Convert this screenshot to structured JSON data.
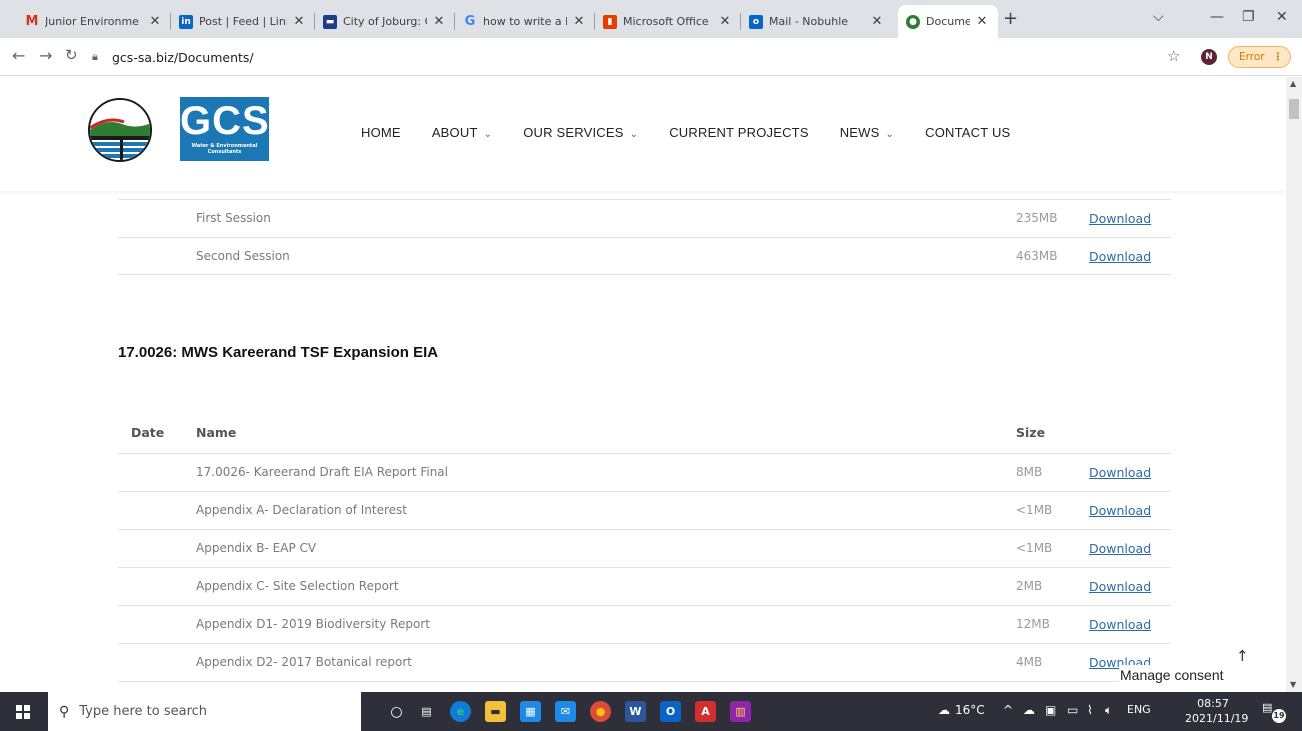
{
  "browser": {
    "tabs": [
      {
        "label": "Junior Environme",
        "icon": "gmail-icon"
      },
      {
        "label": "Post | Feed | Link",
        "icon": "linkedin-icon"
      },
      {
        "label": "City of Joburg: C",
        "icon": "joburg-icon"
      },
      {
        "label": "how to write a le",
        "icon": "google-icon"
      },
      {
        "label": "Microsoft Office",
        "icon": "office-icon"
      },
      {
        "label": "Mail - Nobuhle",
        "icon": "outlook-icon"
      },
      {
        "label": "Documents – GC",
        "icon": "gcs-icon"
      }
    ],
    "url": "gcs-sa.biz/Documents/",
    "profile_initial": "N",
    "error_label": "Error"
  },
  "site": {
    "logo_text": "GCS",
    "logo_subtitle_1": "Water & Environmental",
    "logo_subtitle_2": "Consultants",
    "nav": [
      {
        "label": "HOME",
        "dropdown": false
      },
      {
        "label": "ABOUT",
        "dropdown": true
      },
      {
        "label": "OUR SERVICES",
        "dropdown": true
      },
      {
        "label": "CURRENT PROJECTS",
        "dropdown": false
      },
      {
        "label": "NEWS",
        "dropdown": true
      },
      {
        "label": "CONTACT US",
        "dropdown": false
      }
    ]
  },
  "previous_section": {
    "rows": [
      {
        "name": "First Session",
        "size": "235MB",
        "action": "Download"
      },
      {
        "name": "Second Session",
        "size": "463MB",
        "action": "Download"
      }
    ]
  },
  "section": {
    "title": "17.0026: MWS Kareerand TSF Expansion EIA",
    "headers": {
      "date": "Date",
      "name": "Name",
      "size": "Size"
    },
    "rows": [
      {
        "name": "17.0026- Kareerand Draft EIA Report Final",
        "size": "8MB",
        "action": "Download"
      },
      {
        "name": "Appendix A- Declaration of Interest",
        "size": "<1MB",
        "action": "Download"
      },
      {
        "name": "Appendix B- EAP CV",
        "size": "<1MB",
        "action": "Download"
      },
      {
        "name": "Appendix C- Site Selection Report",
        "size": "2MB",
        "action": "Download"
      },
      {
        "name": "Appendix D1- 2019 Biodiversity Report",
        "size": "12MB",
        "action": "Download"
      },
      {
        "name": "Appendix D2- 2017 Botanical report",
        "size": "4MB",
        "action": "Download"
      }
    ]
  },
  "overlay": {
    "consent": "Manage consent",
    "to_top": "↑"
  },
  "taskbar": {
    "search_placeholder": "Type here to search",
    "weather": "16°C",
    "lang": "ENG",
    "time": "08:57",
    "date": "2021/11/19",
    "notifications": "19"
  },
  "colors": {
    "brand_blue": "#1c78b4",
    "link": "#2d6aa8",
    "taskbar": "#2f2f39"
  }
}
